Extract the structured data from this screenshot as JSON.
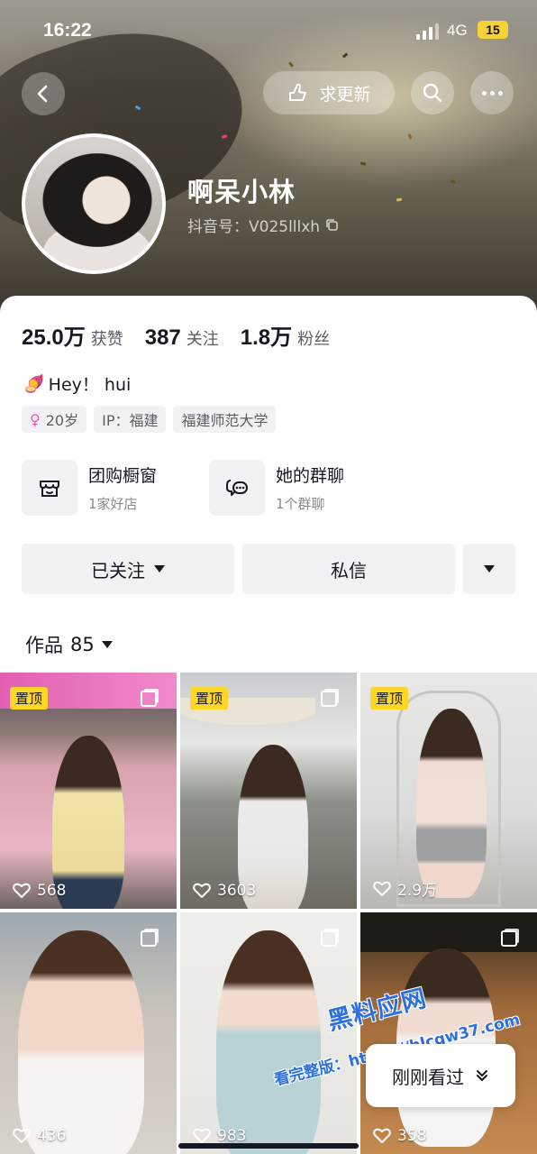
{
  "status_bar": {
    "time": "16:22",
    "network": "4G",
    "battery": "15"
  },
  "header": {
    "update_button_label": "求更新",
    "nickname": "啊呆小林",
    "douyin_id": "抖音号：V025lllxh",
    "icons": {
      "back": "back-arrow-icon",
      "update": "hand-point-icon",
      "search": "search-icon",
      "more": "more-dots-icon",
      "copy": "copy-icon"
    }
  },
  "stats": [
    {
      "value": "25.0万",
      "label": "获赞"
    },
    {
      "value": "387",
      "label": "关注"
    },
    {
      "value": "1.8万",
      "label": "粉丝"
    }
  ],
  "bio": {
    "emoji": "🍠",
    "text": "Hey！ hui"
  },
  "tags": [
    {
      "text": "20岁",
      "icon": "female-icon"
    },
    {
      "text": "IP：福建"
    },
    {
      "text": "福建师范大学"
    }
  ],
  "entries": [
    {
      "title": "团购橱窗",
      "subtitle": "1家好店",
      "icon": "shop-icon"
    },
    {
      "title": "她的群聊",
      "subtitle": "1个群聊",
      "icon": "chat-group-icon"
    }
  ],
  "actions": {
    "follow_label": "已关注",
    "message_label": "私信"
  },
  "works": {
    "label": "作品",
    "count": "85"
  },
  "grid": [
    {
      "pinned": true,
      "pin_label": "置顶",
      "likes": "568"
    },
    {
      "pinned": true,
      "pin_label": "置顶",
      "likes": "3603"
    },
    {
      "pinned": true,
      "pin_label": "置顶",
      "likes": "2.9万"
    },
    {
      "pinned": false,
      "likes": "436"
    },
    {
      "pinned": false,
      "likes": "983"
    },
    {
      "pinned": false,
      "likes": "358"
    }
  ],
  "recent_button": {
    "label": "刚刚看过"
  },
  "watermark": {
    "line1": "黑料应网",
    "line2": "看完整版：https://hlcgw37.com"
  },
  "colors": {
    "pin_badge": "#fcd728",
    "text_primary": "#161823",
    "text_secondary": "#5c5d65",
    "watermark": "#2b6fe0"
  }
}
